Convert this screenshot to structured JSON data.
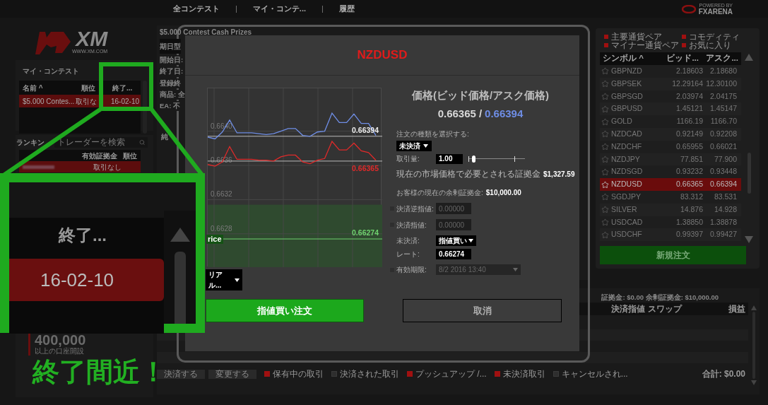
{
  "top_nav": {
    "items": [
      {
        "kind": "link",
        "label": "全コンテスト"
      },
      {
        "kind": "separator",
        "label": "|"
      },
      {
        "kind": "link",
        "label": "マイ・コンテ..."
      },
      {
        "kind": "separator",
        "label": "|"
      },
      {
        "kind": "link",
        "label": "履歴"
      }
    ],
    "powered_by": "POWERED BY",
    "brand": "FXARENA"
  },
  "logo": {
    "text": "XM",
    "url": "WWW.XM.COM"
  },
  "my_contests": {
    "title": "マイ・コンテスト",
    "columns": [
      "名前 ^",
      "順位",
      "終了..."
    ],
    "rows": [
      {
        "name": "$5.000 Contes...",
        "rank": "取引な",
        "end": "16-02-10",
        "selected": true
      }
    ]
  },
  "ranking": {
    "title": "ランキン",
    "search": {
      "placeholder": "トレーダーを検索"
    },
    "columns": [
      "有効証拠金",
      "順位"
    ],
    "rows": [
      {
        "status": "取引なし",
        "selected": true
      }
    ]
  },
  "promo": {
    "amount": "400,000",
    "caption": "以上の口座開設"
  },
  "contest": {
    "title": "$5.000 Contest Cash Prizes",
    "type": "期日型",
    "fields": [
      "開始日:",
      "終了日:",
      "登録終",
      "商品: 全",
      "EA: 不"
    ],
    "section": "純"
  },
  "symbols": {
    "filters": [
      {
        "label": "主要通貨ペア",
        "checked": true
      },
      {
        "label": "コモディティ",
        "checked": true
      },
      {
        "label": "マイナー通貨ペア",
        "checked": true
      },
      {
        "label": "お気に入り",
        "checked": true
      }
    ],
    "columns": [
      "シンボル ^",
      "ビッド...",
      "アスク..."
    ],
    "rows": [
      {
        "symbol": "GBPNZD",
        "bid": "2.18603",
        "ask": "2.18680",
        "selected": false
      },
      {
        "symbol": "GBPSEK",
        "bid": "12.29164",
        "ask": "12.30100",
        "selected": false
      },
      {
        "symbol": "GBPSGD",
        "bid": "2.03974",
        "ask": "2.04175",
        "selected": false
      },
      {
        "symbol": "GBPUSD",
        "bid": "1.45121",
        "ask": "1.45147",
        "selected": false
      },
      {
        "symbol": "GOLD",
        "bid": "1166.19",
        "ask": "1166.70",
        "selected": false
      },
      {
        "symbol": "NZDCAD",
        "bid": "0.92149",
        "ask": "0.92208",
        "selected": false
      },
      {
        "symbol": "NZDCHF",
        "bid": "0.65955",
        "ask": "0.66021",
        "selected": false
      },
      {
        "symbol": "NZDJPY",
        "bid": "77.851",
        "ask": "77.900",
        "selected": false
      },
      {
        "symbol": "NZDSGD",
        "bid": "0.93232",
        "ask": "0.93448",
        "selected": false
      },
      {
        "symbol": "NZDUSD",
        "bid": "0.66365",
        "ask": "0.66394",
        "selected": true
      },
      {
        "symbol": "SGDJPY",
        "bid": "83.312",
        "ask": "83.531",
        "selected": false
      },
      {
        "symbol": "SILVER",
        "bid": "14.876",
        "ask": "14.928",
        "selected": false
      },
      {
        "symbol": "USDCAD",
        "bid": "1.38850",
        "ask": "1.38878",
        "selected": false
      },
      {
        "symbol": "USDCHF",
        "bid": "0.99397",
        "ask": "0.99427",
        "selected": false
      }
    ],
    "new_order_button": "新規注文"
  },
  "trades": {
    "summary": "証拠金: $0.00 余剰証拠金: $10,000.00",
    "columns": [
      "決済指値",
      "スワップ",
      "損益"
    ],
    "buttons": [
      "決済する",
      "変更する"
    ],
    "filters": [
      {
        "label": "保有中の取引",
        "checked": true
      },
      {
        "label": "決済された取引",
        "checked": false
      },
      {
        "label": "プッシュアップ /...",
        "checked": true
      },
      {
        "label": "未決済取引",
        "checked": true
      },
      {
        "label": "キャンセルされ...",
        "checked": false
      }
    ],
    "total": "合計: $0.00"
  },
  "dialog": {
    "title": "NZDUSD",
    "chart": {
      "feed": "リアル...",
      "order_tag": "rice",
      "chart_data": {
        "type": "line",
        "ylim": [
          0.66241,
          0.6645
        ],
        "grid": true,
        "yticks": [
          {
            "value": 0.6628,
            "label": "0.6628"
          },
          {
            "value": 0.6632,
            "label": "0.6632"
          },
          {
            "value": 0.6636,
            "label": "0.6636"
          },
          {
            "value": 0.664,
            "label": "0.6640"
          }
        ],
        "series": [
          {
            "color": "#6f8ee6",
            "values": [
              0.66393,
              0.66391,
              0.66399,
              0.66413,
              0.66398,
              0.66398,
              0.66398,
              0.66397,
              0.66396,
              0.66397,
              0.664,
              0.66403,
              0.66403,
              0.66395,
              0.66394,
              0.66399,
              0.664,
              0.66421,
              0.6641,
              0.6641,
              0.6642,
              0.66409,
              0.66409,
              0.66395
            ]
          },
          {
            "color": "#e02a2a",
            "values": [
              0.66361,
              0.66359,
              0.66364,
              0.66382,
              0.66367,
              0.66367,
              0.66367,
              0.66366,
              0.66366,
              0.66365,
              0.6637,
              0.66372,
              0.66372,
              0.66364,
              0.66362,
              0.66366,
              0.66368,
              0.66388,
              0.66378,
              0.66378,
              0.66386,
              0.66377,
              0.66375,
              0.66366
            ]
          }
        ],
        "ref_lines": [
          {
            "axis": "y",
            "value": 0.66394,
            "label": "0.66394",
            "color": "#bbbbbb"
          },
          {
            "axis": "y",
            "value": 0.66365,
            "label": "0.66365",
            "color": "#bbbbbb"
          },
          {
            "axis": "y",
            "value": 0.66274,
            "label": "0.66274",
            "color": "#6fd36f"
          }
        ],
        "bands": [
          {
            "axis": "y",
            "from": 0.66241,
            "to": 0.66314,
            "color": "#2f4a2f"
          }
        ]
      }
    },
    "price_heading": "価格(ビッド価格/アスク価格)",
    "bid": "0.66365",
    "price_separator": "/",
    "ask": "0.66394",
    "order_type_label": "注文の種類を選択する:",
    "order_type": "未決済",
    "volume_label": "取引量:",
    "volume": "1.00",
    "volume_slider": {
      "level": 0.06
    },
    "margin_label": "現在の市場価格で必要とされる証拠金",
    "margin": "$1,327.59",
    "free_margin_label": "お客様の現在の余剰証拠金:",
    "free_margin": "$10,000.00",
    "stop_loss": {
      "label": "決済逆指値:",
      "checked": false,
      "placeholder": "0.00000"
    },
    "take_profit": {
      "label": "決済指値:",
      "checked": false,
      "placeholder": "0.00000"
    },
    "pending_label": "未決済:",
    "pending_type": "指値買い",
    "rate_label": "レート:",
    "rate": "0.66274",
    "expiry": {
      "label": "有効期限:",
      "checked": false,
      "value": "8/2 2016 13:40"
    },
    "submit_button": "指値買い注文",
    "cancel_button": "取消"
  },
  "callout": {
    "header": "終了...",
    "date": "16-02-10",
    "caption": "終了間近！"
  }
}
